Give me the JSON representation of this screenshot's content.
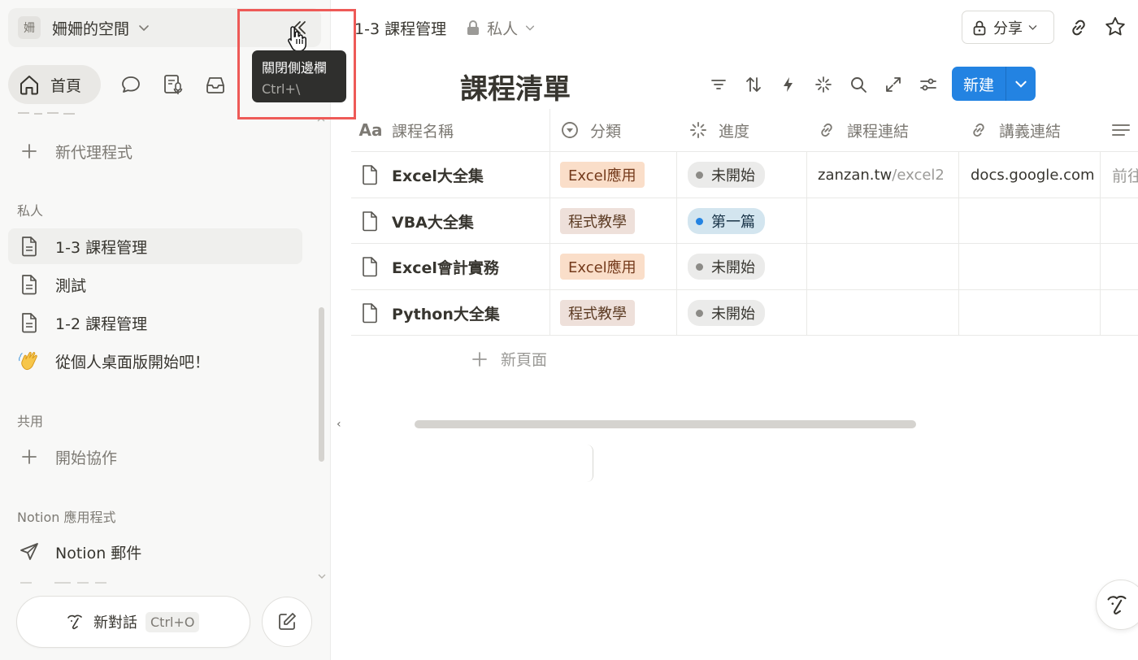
{
  "sidebar": {
    "workspace": {
      "avatar_char": "姍",
      "name": "姍姍的空間"
    },
    "home_label": "首頁",
    "new_agent_label": "新代理程式",
    "private_section_label": "私人",
    "private_items": [
      {
        "label": "1-3 課程管理",
        "icon": "page-icon"
      },
      {
        "label": "測試",
        "icon": "page-icon"
      },
      {
        "label": "1-2 課程管理",
        "icon": "page-icon"
      },
      {
        "label": "從個人桌面版開始吧！",
        "icon": "waving-hand-emoji"
      }
    ],
    "shared_section_label": "共用",
    "start_collab_label": "開始協作",
    "apps_section_label": "Notion 應用程式",
    "mail_label": "Notion 郵件",
    "new_chat_label": "新對話",
    "new_chat_shortcut": "Ctrl+O"
  },
  "tooltip": {
    "title": "關閉側邊欄",
    "shortcut": "Ctrl+\\"
  },
  "header": {
    "breadcrumb_title": "1-3 課程管理",
    "privacy_label": "私人",
    "share_label": "分享"
  },
  "database": {
    "title": "課程清單",
    "new_button_label": "新建",
    "columns": [
      {
        "label": "課程名稱",
        "icon": "text-aa-icon"
      },
      {
        "label": "分類",
        "icon": "select-icon"
      },
      {
        "label": "進度",
        "icon": "status-icon"
      },
      {
        "label": "課程連結",
        "icon": "link-icon"
      },
      {
        "label": "講義連結",
        "icon": "link-icon"
      }
    ],
    "rows": [
      {
        "name": "Excel大全集",
        "category": "Excel應用",
        "category_style": "excel",
        "status": "未開始",
        "status_style": "gray",
        "course_link_domain": "zanzan.tw",
        "course_link_path": "/excel2",
        "handout_link": "docs.google.com",
        "extra": "前往"
      },
      {
        "name": "VBA大全集",
        "category": "程式教學",
        "category_style": "prog",
        "status": "第一篇",
        "status_style": "blue",
        "course_link_domain": "",
        "course_link_path": "",
        "handout_link": "",
        "extra": ""
      },
      {
        "name": "Excel會計實務",
        "category": "Excel應用",
        "category_style": "excel",
        "status": "未開始",
        "status_style": "gray",
        "course_link_domain": "",
        "course_link_path": "",
        "handout_link": "",
        "extra": ""
      },
      {
        "name": "Python大全集",
        "category": "程式教學",
        "category_style": "prog",
        "status": "未開始",
        "status_style": "gray",
        "course_link_domain": "",
        "course_link_path": "",
        "handout_link": "",
        "extra": ""
      }
    ],
    "new_page_label": "新頁面"
  },
  "colors": {
    "accent_blue": "#2383e2",
    "highlight_red": "#ee5a57",
    "tag_excel_bg": "#fadec9",
    "tag_prog_bg": "#eee0da",
    "status_gray_bg": "#ebebea",
    "status_blue_bg": "#d3e5ef"
  }
}
